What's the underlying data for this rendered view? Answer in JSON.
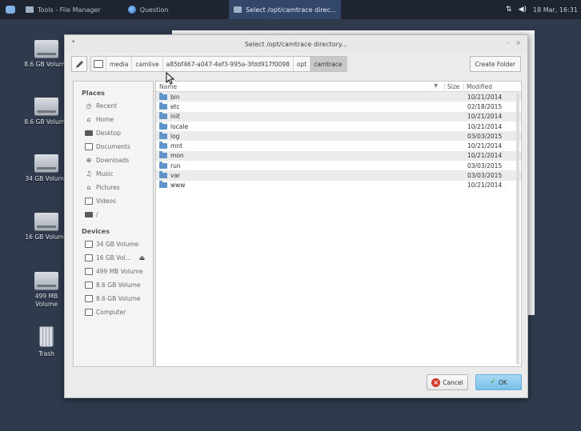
{
  "panel": {
    "tasks": [
      {
        "label": "Tools - File Manager",
        "active": false
      },
      {
        "label": "Question",
        "active": false
      },
      {
        "label": "Select /opt/camtrace direc...",
        "active": true
      }
    ],
    "clock": "18 Mar, 16:31"
  },
  "desktop": {
    "icons": [
      {
        "label": "8.6 GB Volume"
      },
      {
        "label": "8.6 GB Volume"
      },
      {
        "label": "34 GB Volume"
      },
      {
        "label": "16 GB Volume"
      },
      {
        "label": "499 MB Volume"
      },
      {
        "label": "Trash"
      }
    ]
  },
  "dialog": {
    "title": "Select /opt/camtrace directory...",
    "path": [
      "media",
      "camlive",
      "a85bf467-a047-4ef3-995a-3fdd917f0098",
      "opt",
      "camtrace"
    ],
    "create_folder": "Create Folder",
    "places_header": "Places",
    "places": [
      {
        "label": "Recent",
        "icon": "clock-icon"
      },
      {
        "label": "Home",
        "icon": "home-icon"
      },
      {
        "label": "Desktop",
        "icon": "desktop-icon"
      },
      {
        "label": "Documents",
        "icon": "documents-icon"
      },
      {
        "label": "Downloads",
        "icon": "downloads-icon"
      },
      {
        "label": "Music",
        "icon": "music-icon"
      },
      {
        "label": "Pictures",
        "icon": "pictures-icon"
      },
      {
        "label": "Videos",
        "icon": "videos-icon"
      },
      {
        "label": "/",
        "icon": "root-folder-icon"
      }
    ],
    "devices_header": "Devices",
    "devices": [
      {
        "label": "34 GB Volume"
      },
      {
        "label": "16 GB Vol..."
      },
      {
        "label": "499 MB Volume"
      },
      {
        "label": "8.6 GB Volume"
      },
      {
        "label": "8.6 GB Volume"
      },
      {
        "label": "Computer"
      }
    ],
    "columns": {
      "name": "Name",
      "size": "Size",
      "modified": "Modified"
    },
    "files": [
      {
        "name": "bin",
        "modified": "10/21/2014"
      },
      {
        "name": "etc",
        "modified": "02/18/2015"
      },
      {
        "name": "init",
        "modified": "10/21/2014"
      },
      {
        "name": "locale",
        "modified": "10/21/2014"
      },
      {
        "name": "log",
        "modified": "03/03/2015"
      },
      {
        "name": "mnt",
        "modified": "10/21/2014"
      },
      {
        "name": "mon",
        "modified": "10/21/2014"
      },
      {
        "name": "run",
        "modified": "03/03/2015"
      },
      {
        "name": "var",
        "modified": "03/03/2015"
      },
      {
        "name": "www",
        "modified": "10/21/2014"
      }
    ],
    "cancel_label": "Cancel",
    "ok_label": "OK"
  },
  "colors": {
    "desktop_bg": "#2f3a4d",
    "panel_bg": "#1e2530",
    "active_task": "#33476a",
    "folder": "#5f93c9",
    "ok_button": "#78bfe8",
    "cancel_icon": "#d23c2c"
  }
}
